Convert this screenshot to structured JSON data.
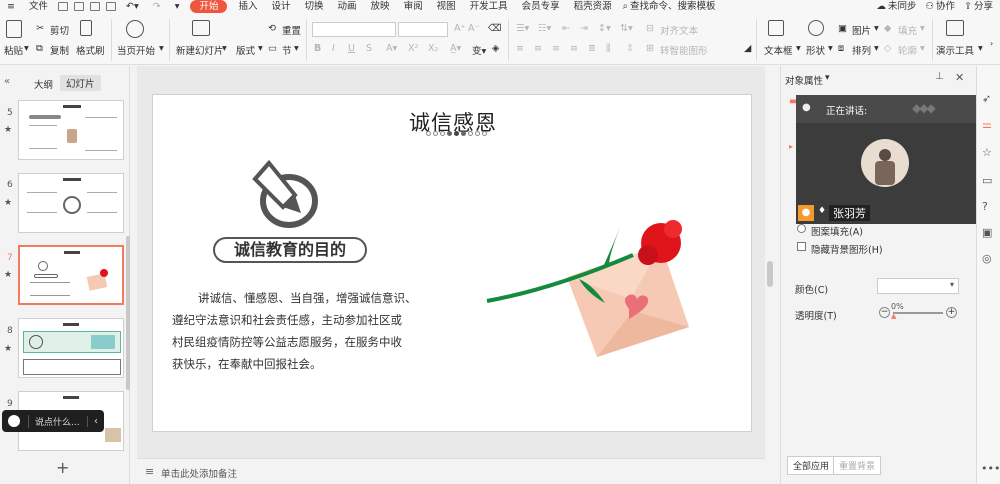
{
  "menubar": {
    "file": "文件",
    "tabs": [
      "开始",
      "插入",
      "设计",
      "切换",
      "动画",
      "放映",
      "审阅",
      "视图",
      "开发工具",
      "会员专享",
      "稻壳资源"
    ],
    "search": "查找命令、搜索模板",
    "right": [
      "未同步",
      "协作",
      "分享"
    ]
  },
  "ribbon": {
    "paste": "粘贴",
    "cut": "剪切",
    "copy": "复制",
    "format_brush": "格式刷",
    "from_current": "当页开始",
    "new_slide": "新建幻灯片",
    "layout": "版式",
    "section": "节",
    "reset": "重置",
    "align_text": "对齐文本",
    "smart_art": "转智能图形",
    "textbox": "文本框",
    "shape": "形状",
    "arrange": "排列",
    "picture": "图片",
    "fill": "填充",
    "outline": "轮廓",
    "presentation_tools": "演示工具"
  },
  "left_pane": {
    "tab_outline": "大纲",
    "tab_slides": "幻灯片",
    "slides": [
      "5",
      "6",
      "7",
      "8",
      "9"
    ],
    "selected": "7",
    "comment_placeholder": "说点什么...",
    "add": "+"
  },
  "slide": {
    "title": "诚信感恩",
    "subtitle": "诚信教育的目的",
    "body": [
      "讲诚信、懂感恩、当自强，增强诚信意识、",
      "遵纪守法意识和社会责任感，主动参加社区或",
      "村民组疫情防控等公益志愿服务，在服务中收",
      "获快乐，在奉献中回报社会。"
    ],
    "colors": {
      "flower": "#e0141b",
      "stem": "#138a3e",
      "envelope": "#f5c9b3",
      "heart": "#ea6f78"
    }
  },
  "notes": {
    "placeholder": "单击此处添加备注"
  },
  "right_pane": {
    "title": "对象属性",
    "speaking": "正在讲话:",
    "speaker": "张羽芳",
    "pattern_fill": "图案填充(A)",
    "hide_bg": "隐藏背景图形(H)",
    "color_label": "颜色(C)",
    "transparency_label": "透明度(T)",
    "transparency_value": "0%",
    "apply_all": "全部应用",
    "reset_bg": "重置背景"
  }
}
